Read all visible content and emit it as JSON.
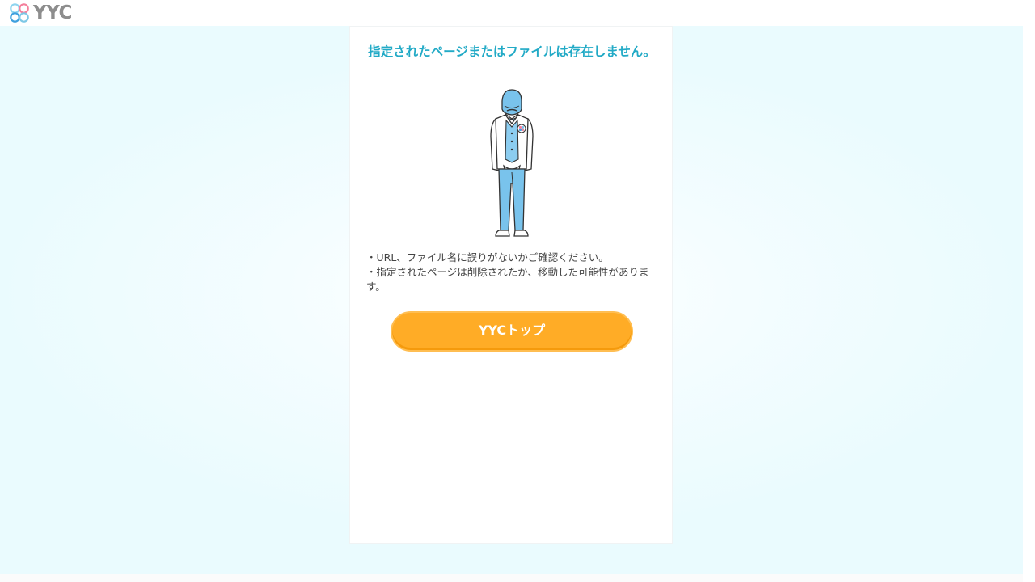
{
  "header": {
    "logo_text": "YYC"
  },
  "main": {
    "title": "指定されたページまたはファイルは存在しません。",
    "messages": [
      "・URL、ファイル名に誤りがないかご確認ください。",
      "・指定されたページは削除されたか、移動した可能性があります。"
    ],
    "button_label": "YYCトップ"
  },
  "colors": {
    "title": "#22aac6",
    "button": "#ffac26",
    "background": "#eafbfe",
    "logo_text": "#8d8d8d"
  },
  "icons": {
    "logo": "clover-logo-icon",
    "illustration": "bowing-man-illustration"
  }
}
